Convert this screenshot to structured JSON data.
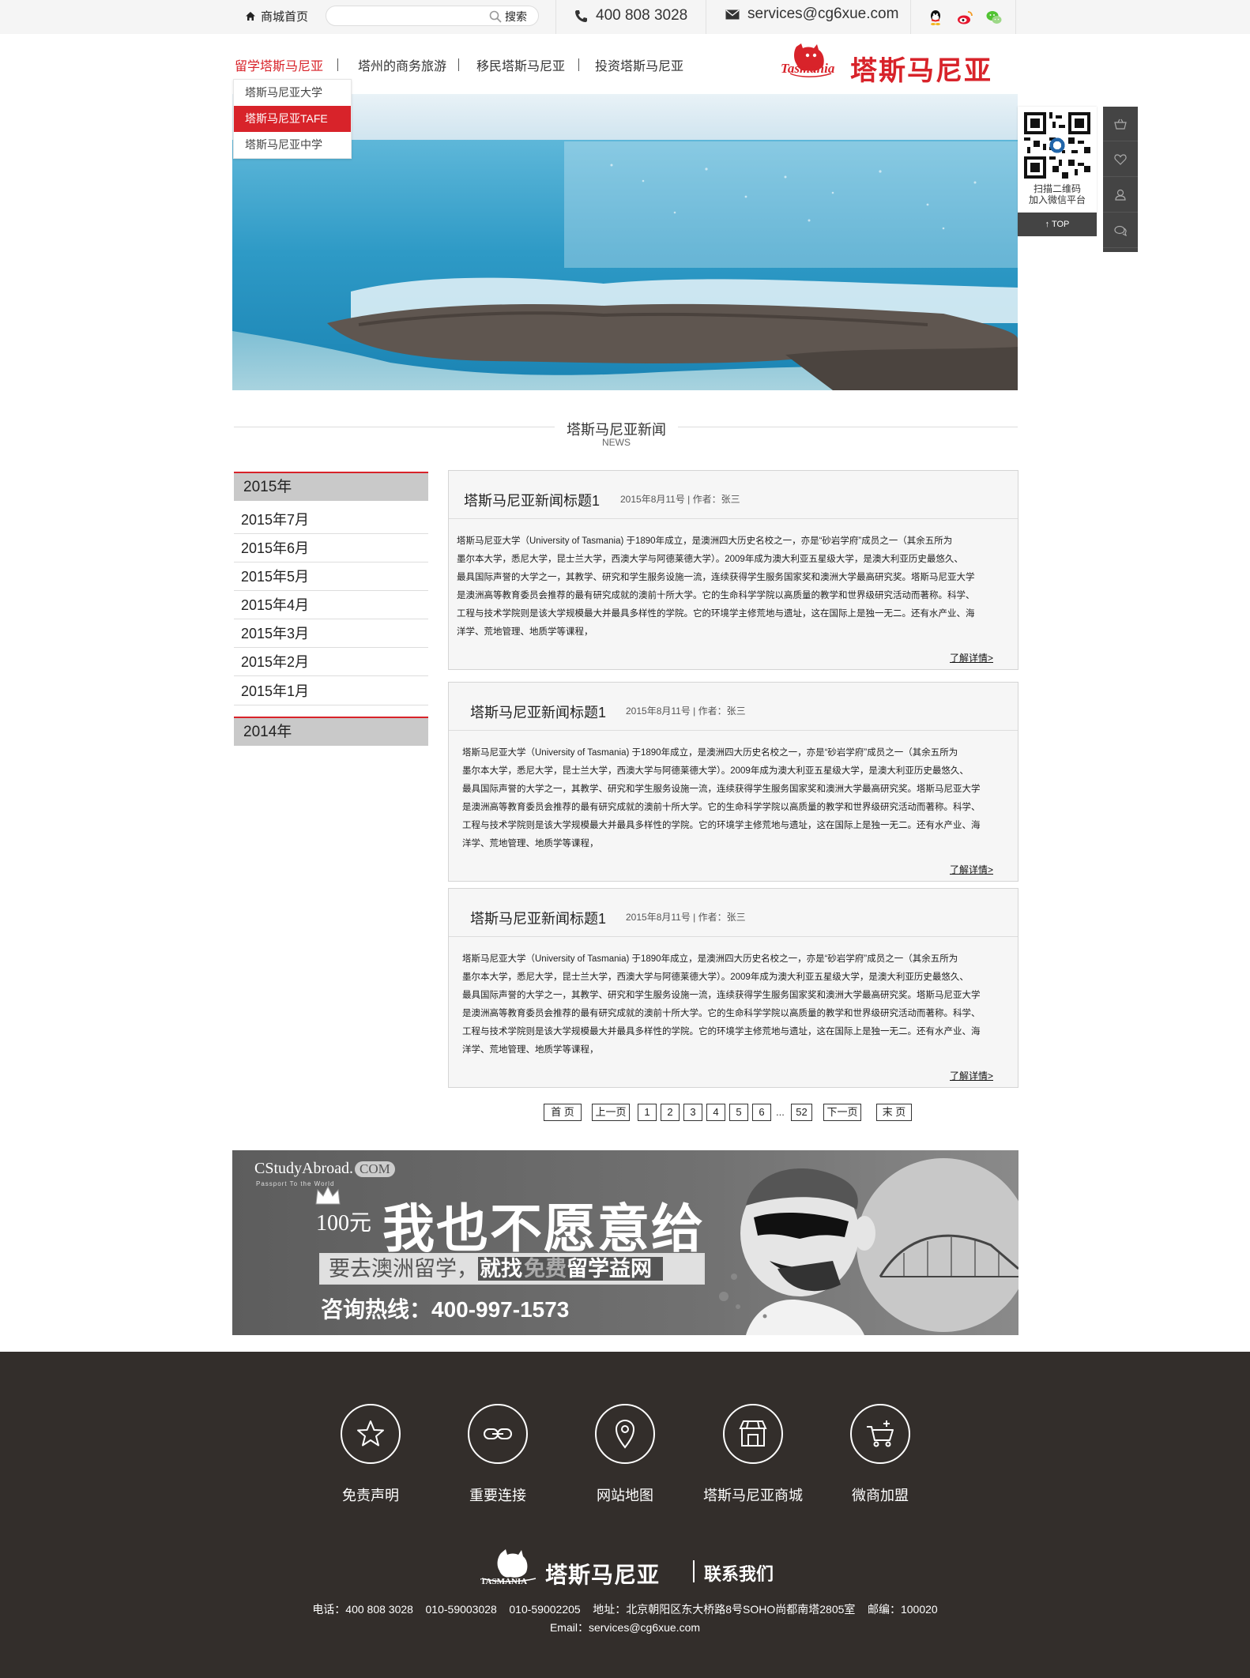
{
  "topbar": {
    "home_label": "商城首页",
    "search_placeholder": "",
    "search_label": "搜索",
    "phone": "400 808 3028",
    "email": "services@cg6xue.com",
    "social": [
      "qq-icon",
      "weibo-icon",
      "wechat-icon"
    ]
  },
  "nav": {
    "items": [
      "留学塔斯马尼亚",
      "塔州的商务旅游",
      "移民塔斯马尼亚",
      "投资塔斯马尼亚"
    ],
    "active_index": 0,
    "logo_name": "塔斯马尼亚",
    "logo_en": "Tasmania"
  },
  "dropdown": {
    "items": [
      "塔斯马尼亚大学",
      "塔斯马尼亚TAFE",
      "塔斯马尼亚中学"
    ],
    "active_index": 1
  },
  "side": {
    "qr_caption_1": "扫描二维码",
    "qr_caption_2": "加入微信平台",
    "top_label": "TOP",
    "buttons": [
      "basket-icon",
      "heart-icon",
      "user-icon",
      "chat-icon"
    ]
  },
  "section": {
    "title": "塔斯马尼亚新闻",
    "subtitle": "NEWS"
  },
  "archive": {
    "year_2015": "2015年",
    "months": [
      "2015年7月",
      "2015年6月",
      "2015年5月",
      "2015年4月",
      "2015年3月",
      "2015年2月",
      "2015年1月"
    ],
    "year_2014": "2014年"
  },
  "articles": [
    {
      "title": "塔斯马尼亚新闻标题1",
      "meta": "2015年8月11号 | 作者：张三",
      "lines": [
        "塔斯马尼亚大学（University of Tasmania) 于1890年成立，是澳洲四大历史名校之一，亦是“砂岩学府”成员之一（其余五所为",
        "墨尔本大学，悉尼大学，昆士兰大学，西澳大学与阿德莱德大学）。2009年成为澳大利亚五星级大学，是澳大利亚历史最悠久、",
        "最具国际声誉的大学之一，其教学、研究和学生服务设施一流，连续获得学生服务国家奖和澳洲大学最高研究奖。塔斯马尼亚大学",
        "是澳洲高等教育委员会推荐的最有研究成就的澳前十所大学。它的生命科学学院以高质量的教学和世界级研究活动而著称。科学、",
        "工程与技术学院则是该大学规模最大并最具多样性的学院。它的环境学主修荒地与遗址，这在国际上是独一无二。还有水产业、海",
        "洋学、荒地管理、地质学等课程，"
      ],
      "more": "了解详情>"
    },
    {
      "title": "塔斯马尼亚新闻标题1",
      "meta": "2015年8月11号 | 作者：张三",
      "lines": [
        "塔斯马尼亚大学（University of Tasmania) 于1890年成立，是澳洲四大历史名校之一，亦是“砂岩学府”成员之一（其余五所为",
        "墨尔本大学，悉尼大学，昆士兰大学，西澳大学与阿德莱德大学）。2009年成为澳大利亚五星级大学，是澳大利亚历史最悠久、",
        "最具国际声誉的大学之一，其教学、研究和学生服务设施一流，连续获得学生服务国家奖和澳洲大学最高研究奖。塔斯马尼亚大学",
        "是澳洲高等教育委员会推荐的最有研究成就的澳前十所大学。它的生命科学学院以高质量的教学和世界级研究活动而著称。科学、",
        "工程与技术学院则是该大学规模最大并最具多样性的学院。它的环境学主修荒地与遗址，这在国际上是独一无二。还有水产业、海",
        "洋学、荒地管理、地质学等课程，"
      ],
      "more": "了解详情>"
    },
    {
      "title": "塔斯马尼亚新闻标题1",
      "meta": "2015年8月11号 | 作者：张三",
      "lines": [
        "塔斯马尼亚大学（University of Tasmania) 于1890年成立，是澳洲四大历史名校之一，亦是“砂岩学府”成员之一（其余五所为",
        "墨尔本大学，悉尼大学，昆士兰大学，西澳大学与阿德莱德大学）。2009年成为澳大利亚五星级大学，是澳大利亚历史最悠久、",
        "最具国际声誉的大学之一，其教学、研究和学生服务设施一流，连续获得学生服务国家奖和澳洲大学最高研究奖。塔斯马尼亚大学",
        "是澳洲高等教育委员会推荐的最有研究成就的澳前十所大学。它的生命科学学院以高质量的教学和世界级研究活动而著称。科学、",
        "工程与技术学院则是该大学规模最大并最具多样性的学院。它的环境学主修荒地与遗址，这在国际上是独一无二。还有水产业、海",
        "洋学、荒地管理、地质学等课程，"
      ],
      "more": "了解详情>"
    }
  ],
  "pagination": {
    "first": "首 页",
    "prev": "上一页",
    "pages": [
      "1",
      "2",
      "3",
      "4",
      "5",
      "6"
    ],
    "dots": "...",
    "last_page": "52",
    "next": "下一页",
    "last": "末 页"
  },
  "ad": {
    "brand": "CStudyAbroad.",
    "brand_com": "COM",
    "brand_tag": "Passport To the World",
    "price": "100元",
    "slogan": "我也不愿意给",
    "sub_a": "要去澳洲留学，",
    "sub_b": "就找",
    "sub_c": "免费",
    "sub_d": "留学益网",
    "hotline": "咨询热线：400-997-1573"
  },
  "footer": {
    "links": [
      {
        "label": "免责声明",
        "icon": "star-icon"
      },
      {
        "label": "重要连接",
        "icon": "link-icon"
      },
      {
        "label": "网站地图",
        "icon": "map-pin-icon"
      },
      {
        "label": "塔斯马尼亚商城",
        "icon": "store-icon"
      },
      {
        "label": "微商加盟",
        "icon": "cart-icon"
      }
    ],
    "logo_name": "塔斯马尼亚",
    "logo_en": "TASMANIA",
    "contact_label": "联系我们",
    "info_line": "电话：400 808 3028    010-59003028    010-59002205    地址：北京朝阳区东大桥路8号SOHO尚都南塔2805室    邮编：100020",
    "email_line": "Email：services@cg6xue.com"
  },
  "colors": {
    "accent": "#d8232a",
    "footer_bg": "#332e2b",
    "sidebar_year_bg": "#c9c9c9"
  }
}
